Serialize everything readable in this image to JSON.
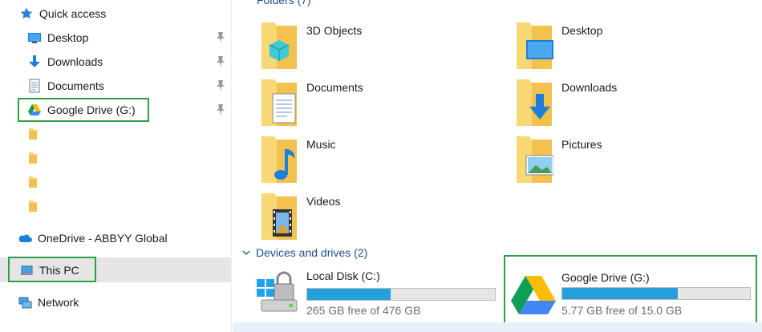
{
  "nav": {
    "quick_access": "Quick access",
    "items": [
      {
        "label": "Desktop",
        "icon": "desktop-icon",
        "pinned": true
      },
      {
        "label": "Downloads",
        "icon": "downloads-icon",
        "pinned": true
      },
      {
        "label": "Documents",
        "icon": "documents-icon",
        "pinned": true
      },
      {
        "label": "Google Drive (G:)",
        "icon": "google-drive-icon",
        "pinned": true
      }
    ],
    "onedrive": "OneDrive - ABBYY Global",
    "this_pc": "This PC",
    "network": "Network"
  },
  "content": {
    "folders_header": "Folders (7)",
    "folders": [
      {
        "label": "3D Objects"
      },
      {
        "label": "Desktop"
      },
      {
        "label": "Documents"
      },
      {
        "label": "Downloads"
      },
      {
        "label": "Music"
      },
      {
        "label": "Pictures"
      },
      {
        "label": "Videos"
      }
    ],
    "devices_header": "Devices and drives (2)",
    "drives": [
      {
        "name": "Local Disk (C:)",
        "free": "265 GB free of 476 GB",
        "used_fraction": 0.443
      },
      {
        "name": "Google Drive (G:)",
        "free": "5.77 GB free of 15.0 GB",
        "used_fraction": 0.615
      }
    ]
  },
  "colors": {
    "accent": "#26a0da",
    "highlight": "#2ea043",
    "folder": "#f8d775"
  }
}
